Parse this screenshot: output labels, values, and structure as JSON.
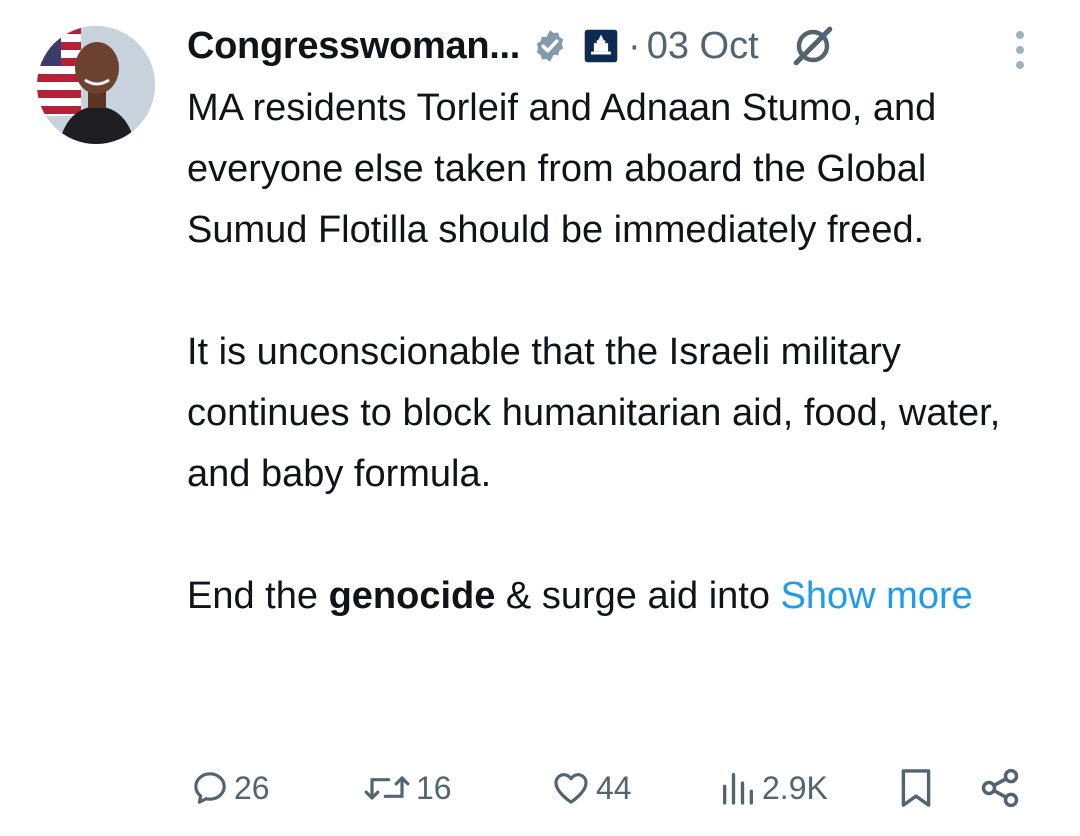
{
  "author": {
    "display_name": "Congresswoman...",
    "avatar_icon": "avatar-photo"
  },
  "meta": {
    "separator": "·",
    "date": "03 Oct"
  },
  "tweet": {
    "paragraph1": "MA residents Torleif and Adnaan Stumo, and everyone else taken from aboard the Global Sumud Flotilla should be immediately freed.",
    "paragraph2": "It is unconscionable that the Israeli military continues to block humanitarian aid, food, water, and baby formula.",
    "paragraph3_before": "End the ",
    "paragraph3_bold": "genocide",
    "paragraph3_after": " & surge aid into ",
    "show_more": "Show more"
  },
  "actions": {
    "replies": "26",
    "reposts": "16",
    "likes": "44",
    "views": "2.9K"
  },
  "colors": {
    "text": "#0f1419",
    "secondary": "#536471",
    "link": "#1d9bf0",
    "verified_badge": "#829aab"
  }
}
